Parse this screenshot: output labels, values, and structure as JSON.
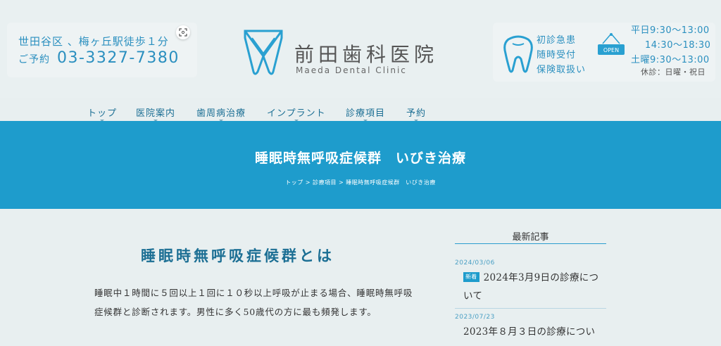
{
  "header": {
    "address": "世田谷区 、梅ヶ丘駅徒歩１分",
    "reservation_label": "ご予約",
    "phone": "03-3327-7380",
    "logo_jp": "前田歯科医院",
    "logo_en": "Maeda Dental Clinic",
    "features": [
      "初診急患",
      "随時受付",
      "保険取扱い"
    ],
    "open_sign": "OPEN",
    "hours": [
      "平日9:30〜13:00",
      "14:30〜18:30",
      "土曜9:30〜13:00"
    ],
    "closed": "休診：日曜・祝日"
  },
  "nav": {
    "items": [
      "トップ",
      "医院案内",
      "歯周病治療",
      "インプラント",
      "診療項目",
      "予約"
    ]
  },
  "hero": {
    "title": "睡眠時無呼吸症候群　いびき治療",
    "breadcrumb": "トップ > 診療項目 > 睡眠時無呼吸症候群　いびき治療"
  },
  "main": {
    "title": "睡眠時無呼吸症候群とは",
    "body": "睡眠中１時間に５回以上１回に１０秒以上呼吸が止まる場合、睡眠時無呼吸症候群と診断されます。男性に多く50歳代の方に最も頻発します。"
  },
  "sidebar": {
    "heading": "最新記事",
    "posts": [
      {
        "date": "2024/03/06",
        "badge": "新着",
        "title_line1": "2024年3月9日の診療につ",
        "title_line2": "いて"
      },
      {
        "date": "2023/07/23",
        "title_line1": "2023年８月３日の診療につい"
      }
    ]
  },
  "colors": {
    "accent": "#1e9ccc",
    "text_blue": "#2a8fbf",
    "background": "#e8eff0"
  }
}
